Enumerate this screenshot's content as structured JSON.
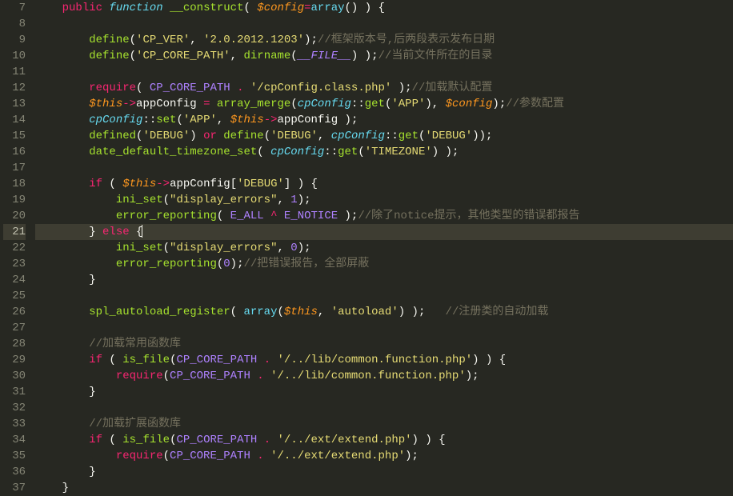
{
  "editor": {
    "lineNumbers": [
      "7",
      "8",
      "9",
      "10",
      "11",
      "12",
      "13",
      "14",
      "15",
      "16",
      "17",
      "18",
      "19",
      "20",
      "21",
      "22",
      "23",
      "24",
      "25",
      "26",
      "27",
      "28",
      "29",
      "30",
      "31",
      "32",
      "33",
      "34",
      "35",
      "36",
      "37"
    ],
    "activeLine": "21",
    "tokens": {
      "public": "public",
      "function": "function",
      "construct": "__construct",
      "config_param": "$config",
      "array": "array",
      "define": "define",
      "require": "require",
      "defined": "defined",
      "this": "$this",
      "if": "if",
      "else": "else",
      "or": "or",
      "dirname": "dirname",
      "array_merge": "array_merge",
      "set": "set",
      "get": "get",
      "ini_set": "ini_set",
      "error_reporting": "error_reporting",
      "date_default_timezone_set": "date_default_timezone_set",
      "spl_autoload_register": "spl_autoload_register",
      "is_file": "is_file",
      "appConfig": "appConfig",
      "cpConfig": "cpConfig",
      "FILE": "__FILE__",
      "E_ALL": "E_ALL",
      "E_NOTICE": "E_NOTICE",
      "CP_CORE_PATH": "CP_CORE_PATH"
    },
    "strings": {
      "cp_ver": "'CP_VER'",
      "ver_val": "'2.0.2012.1203'",
      "cp_core_path": "'CP_CORE_PATH'",
      "cfg_class": "'/cpConfig.class.php'",
      "app": "'APP'",
      "debug_s": "'DEBUG'",
      "timezone": "'TIMEZONE'",
      "display_errors": "\"display_errors\"",
      "autoload": "'autoload'",
      "common_fn": "'/../lib/common.function.php'",
      "extend": "'/../ext/extend.php'"
    },
    "numbers": {
      "one": "1",
      "zero": "0"
    },
    "comments": {
      "c9": "//框架版本号,后两段表示发布日期",
      "c10": "//当前文件所在的目录",
      "c12": "//加载默认配置",
      "c13": "//参数配置",
      "c20": "//除了notice提示，其他类型的错误都报告",
      "c23": "//把错误报告，全部屏蔽",
      "c26": "//注册类的自动加载",
      "c28": "//加载常用函数库",
      "c33": "//加载扩展函数库"
    }
  }
}
